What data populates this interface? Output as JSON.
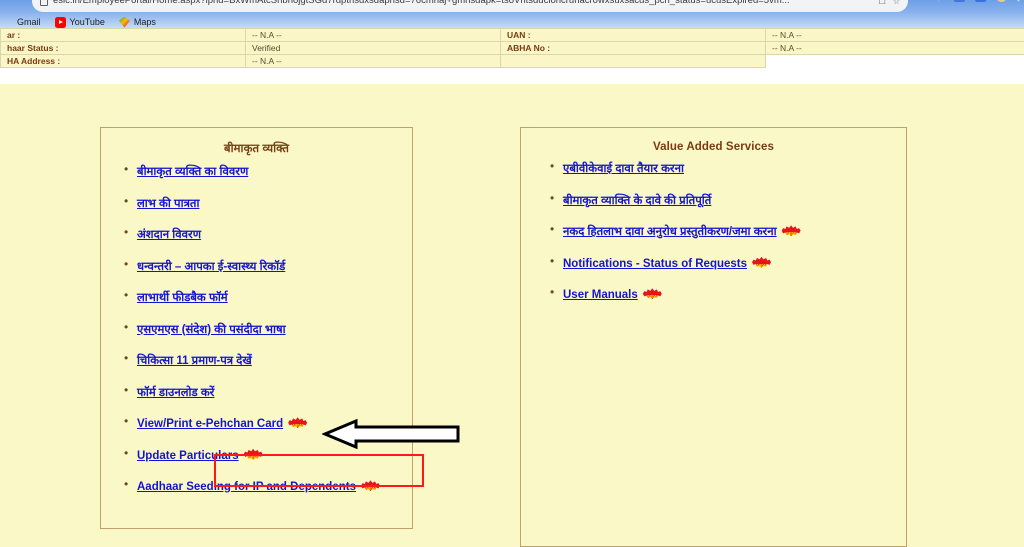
{
  "browser": {
    "url": "esic.in/EmployeePortal/Home.aspx?iphd=BxWmAtcSnbhojgtSGd7rdpthsdxsdaphsd=76cmhaj+gmhsdapk=tsoVhtsducioncruhacrowxsuxsacds_pch_status=ucusExpired=5vm...",
    "bookmarks": [
      {
        "label": "Gmail",
        "icon": "gmail-icon"
      },
      {
        "label": "YouTube",
        "icon": "youtube-icon"
      },
      {
        "label": "Maps",
        "icon": "maps-icon"
      }
    ],
    "toolbar_icons": [
      "share-icon",
      "bookmark-star-icon",
      "extension-icon",
      "profile-avatar-icon",
      "menu-dots-icon"
    ],
    "nav_icons": [
      "back-icon",
      "reload-icon"
    ]
  },
  "info_table": {
    "rows": [
      {
        "label": "ar :",
        "value": "-- N.A --",
        "label2": "UAN :",
        "value2": "-- N.A --"
      },
      {
        "label": "haar Status :",
        "value": "Verified",
        "label2": "ABHA No :",
        "value2": "-- N.A --"
      },
      {
        "label": "HA Address :",
        "value": "-- N.A --",
        "label2": "",
        "value2": ""
      }
    ]
  },
  "panels": {
    "left": {
      "title": "बीमाकृत व्यक्ति",
      "items": [
        {
          "label": "बीमाकृत व्यक्ति का विवरण",
          "badge": false,
          "hindi": true
        },
        {
          "label": "लाभ की पात्रता",
          "badge": false,
          "hindi": true
        },
        {
          "label": "अंशदान विवरण",
          "badge": false,
          "hindi": true
        },
        {
          "label": "धन्वन्तरी – आपका ई-स्वास्थ्य रिकॉर्ड",
          "badge": false,
          "hindi": true
        },
        {
          "label": "लाभार्थी फीडबैक फॉर्म",
          "badge": false,
          "hindi": true
        },
        {
          "label": "एसएमएस (संदेश) की पसंदीदा भाषा",
          "badge": false,
          "hindi": true
        },
        {
          "label": "चिकित्सा 11 प्रमाण-पत्र देखें",
          "badge": false,
          "hindi": true
        },
        {
          "label": "फॉर्म डाउनलोड करें",
          "badge": false,
          "hindi": true
        },
        {
          "label": "View/Print e-Pehchan Card",
          "badge": true,
          "hindi": false,
          "highlighted": true
        },
        {
          "label": "Update Particulars",
          "badge": true,
          "hindi": false
        },
        {
          "label": "Aadhaar Seeding for IP and Dependents",
          "badge": true,
          "hindi": false
        }
      ]
    },
    "right": {
      "title": "Value Added Services",
      "items": [
        {
          "label": "एबीवीकेवाई दावा तैयार करना",
          "badge": false,
          "hindi": true
        },
        {
          "label": "बीमाकृत व्याक्ति के दावे की प्रतिपूर्ति",
          "badge": false,
          "hindi": true
        },
        {
          "label": "नकद हितलाभ दावा अनुरोध प्रस्तुतीकरण/जमा करना",
          "badge": true,
          "hindi": true
        },
        {
          "label": "Notifications - Status of Requests",
          "badge": true,
          "hindi": false
        },
        {
          "label": "User Manuals",
          "badge": true,
          "hindi": false
        }
      ]
    }
  },
  "annotation": {
    "badge_text": "NEW",
    "highlight_color": "#ff1a1a",
    "arrow_direction": "left",
    "target": "View/Print e-Pehchan Card"
  },
  "colors": {
    "page_background": "#fbf8c8",
    "panel_border": "#c3a06b",
    "title_text": "#7a3b12",
    "link": "#1414d0",
    "badge_red": "#e8141c",
    "annotation_red": "#ff1a1a"
  }
}
